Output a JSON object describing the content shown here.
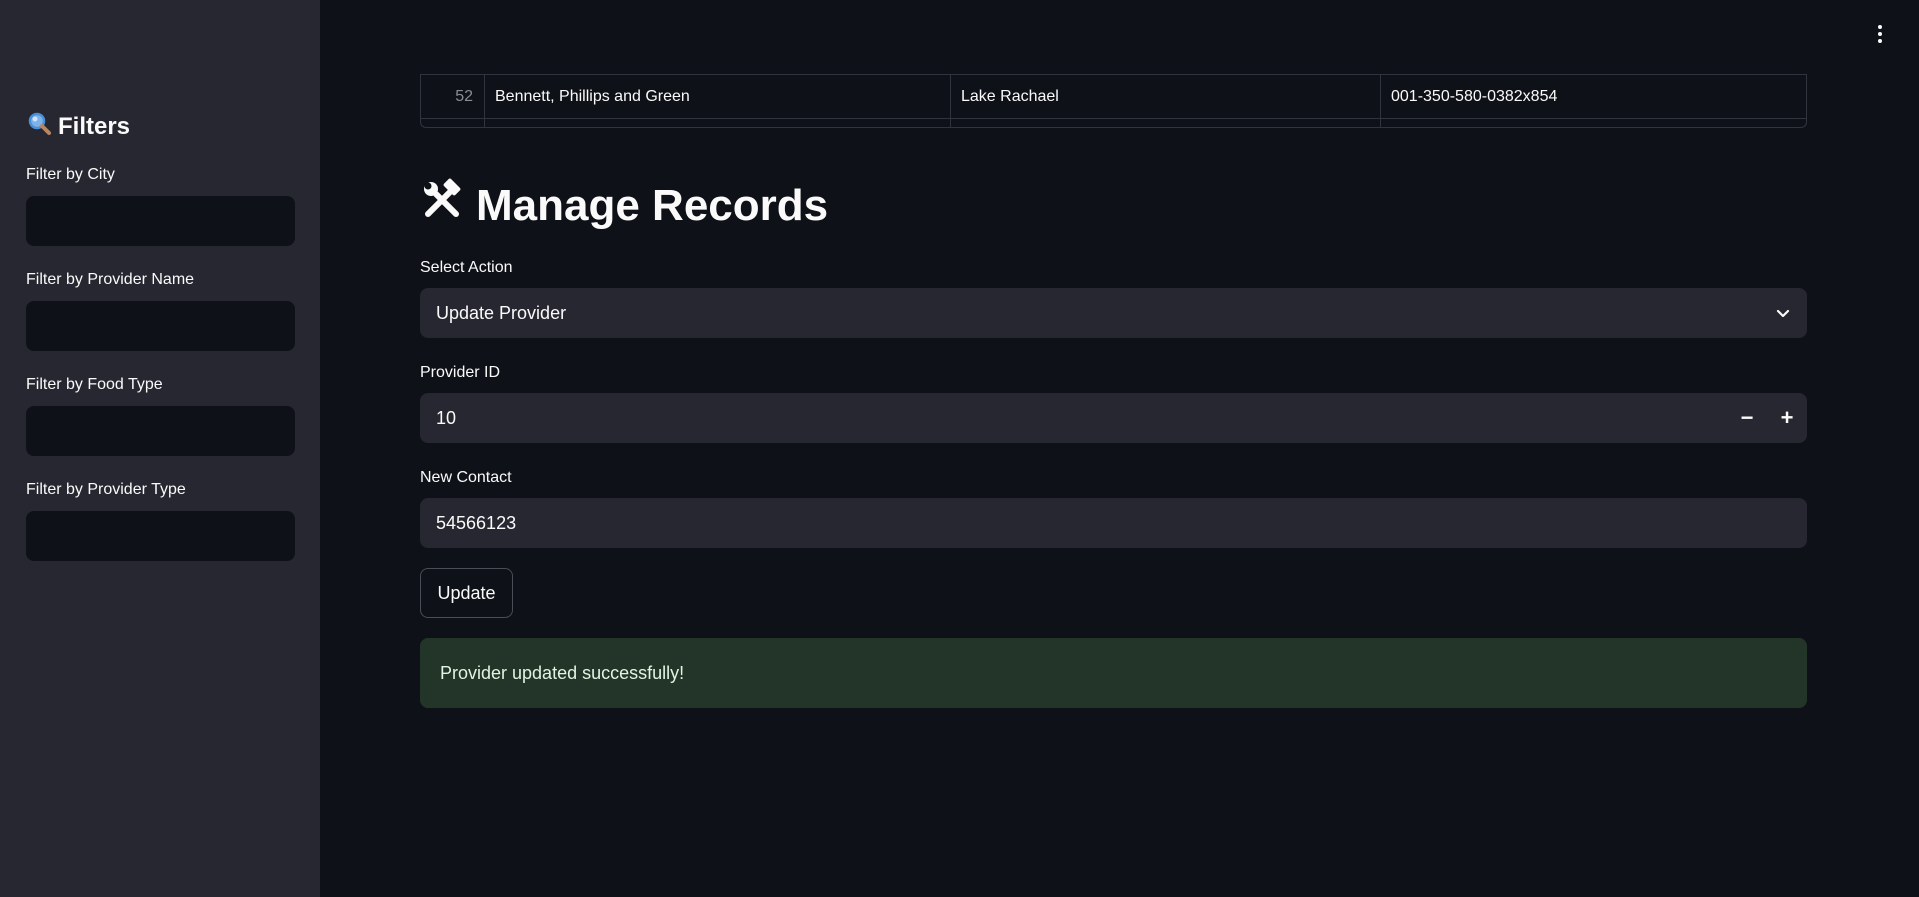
{
  "sidebar": {
    "title": "Filters",
    "title_icon": "magnifier-icon",
    "filters": [
      {
        "label": "Filter by City",
        "value": ""
      },
      {
        "label": "Filter by Provider Name",
        "value": ""
      },
      {
        "label": "Filter by Food Type",
        "value": ""
      },
      {
        "label": "Filter by Provider Type",
        "value": ""
      }
    ]
  },
  "table": {
    "rows": [
      {
        "index": "52",
        "name": "Bennett, Phillips and Green",
        "city": "Lake Rachael",
        "contact": "001-350-580-0382x854"
      }
    ]
  },
  "main": {
    "heading": "Manage Records",
    "heading_icon": "hammer-wrench-icon",
    "action_label": "Select Action",
    "action_value": "Update Provider",
    "provider_id_label": "Provider ID",
    "provider_id_value": "10",
    "stepper_minus": "−",
    "stepper_plus": "+",
    "contact_label": "New Contact",
    "contact_value": "54566123",
    "update_button": "Update",
    "success_message": "Provider updated successfully!"
  },
  "colors": {
    "background": "#0e1117",
    "sidebar": "#262730",
    "field": "#262730",
    "success_bg": "#233528"
  }
}
